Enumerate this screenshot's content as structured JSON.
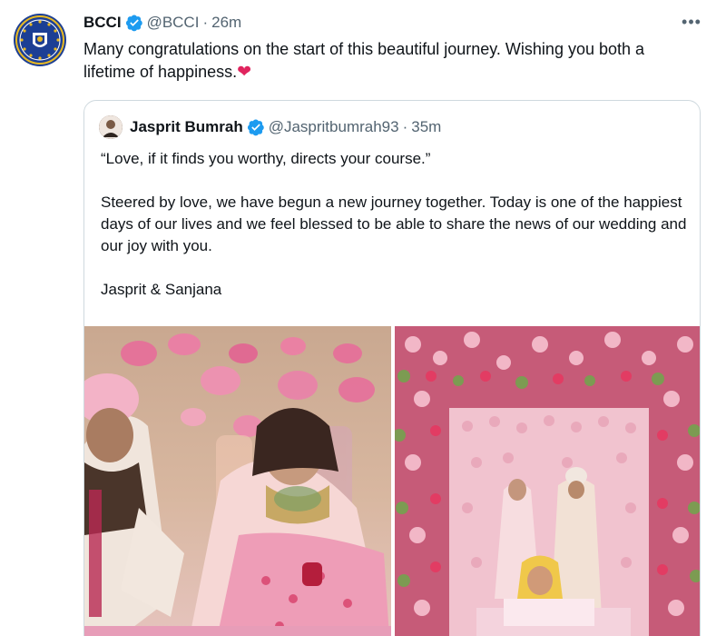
{
  "tweet": {
    "author_name": "BCCI",
    "author_handle": "@BCCI",
    "separator": "·",
    "time": "26m",
    "text": "Many congratulations on the start of this beautiful journey. Wishing you both a lifetime of happiness.",
    "heart_emoji": "❤",
    "more_label": "•••",
    "icons": {
      "avatar": "bcci-logo",
      "verified": "verified-badge-icon",
      "more": "more-options-icon"
    }
  },
  "quoted": {
    "author_name": "Jasprit Bumrah",
    "author_handle": "@Jaspritbumrah93",
    "separator": "·",
    "time": "35m",
    "paragraphs": [
      "“Love, if it finds you worthy, directs your course.”",
      "Steered by love, we have begun a new journey together. Today is one of the happiest days of our lives and we feel blessed to be able to share the news of our wedding and our joy with you.",
      "Jasprit & Sanjana"
    ],
    "photos": [
      "wedding-photo-couple",
      "wedding-photo-flower-wall"
    ]
  },
  "colors": {
    "text": "#0f1419",
    "secondary": "#536471",
    "verified": "#1d9bf0",
    "border": "#cfd9de",
    "heart": "#e0245e"
  }
}
